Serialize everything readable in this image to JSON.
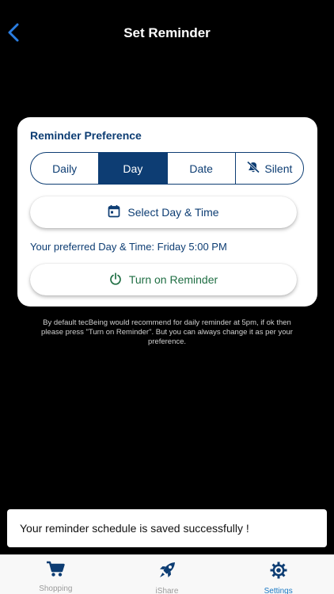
{
  "header": {
    "title": "Set Reminder",
    "back_icon": "chevron-left-icon"
  },
  "card": {
    "heading": "Reminder Preference",
    "segments": [
      {
        "label": "Daily",
        "selected": false
      },
      {
        "label": "Day",
        "selected": true
      },
      {
        "label": "Date",
        "selected": false
      },
      {
        "label": "Silent",
        "selected": false,
        "icon": "bell-off-icon"
      }
    ],
    "select_button": {
      "label": "Select Day & Time",
      "icon": "calendar-icon"
    },
    "preferred_text": "Your preferred Day & Time: Friday 5:00 PM",
    "turn_on_button": {
      "label": "Turn on Reminder",
      "icon": "power-icon"
    }
  },
  "info_text": "By default tecBeing would recommend for daily reminder at 5pm, if ok then please press \"Turn on Reminder\". But you can always change it as per your preference.",
  "toast": {
    "message": "Your reminder schedule is saved successfully !"
  },
  "tab_bar": {
    "tabs": [
      {
        "label": "Shopping",
        "icon": "cart-icon",
        "active": false
      },
      {
        "label": "iShare",
        "icon": "rocket-icon",
        "active": false
      },
      {
        "label": "Settings",
        "icon": "gear-icon",
        "active": true
      }
    ]
  },
  "colors": {
    "primary_navy": "#0d3d73",
    "accent_green": "#1f6e43",
    "tab_active": "#1a79c4",
    "back_blue": "#2a7de1"
  }
}
